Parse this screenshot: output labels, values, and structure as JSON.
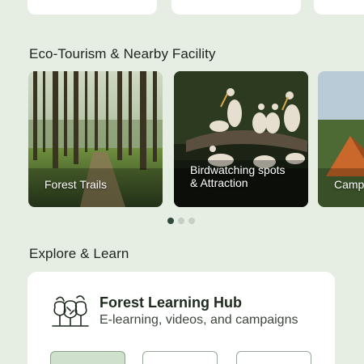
{
  "eco_section": {
    "title": "Eco-Tourism & Nearby Facility",
    "cards": [
      {
        "label": "Forest Trails"
      },
      {
        "label_line1": "Birdwatching spots",
        "label_line2": "& Attraction"
      },
      {
        "label": "Camp"
      }
    ],
    "pagination": {
      "total": 3,
      "active": 1
    }
  },
  "learn_section": {
    "title": "Explore & Learn",
    "hub": {
      "title": "Forest Learning Hub",
      "subtitle": "E-learning, videos, and campaigns",
      "icon": "forest-trees-icon"
    },
    "tabs": [
      {
        "selected": true
      },
      {
        "selected": false
      },
      {
        "selected": false
      }
    ]
  },
  "colors": {
    "background": "#e6eee4",
    "card": "#ffffff",
    "accent_dark": "#2f4a3a",
    "tab_selected": "#cfe0cd"
  }
}
